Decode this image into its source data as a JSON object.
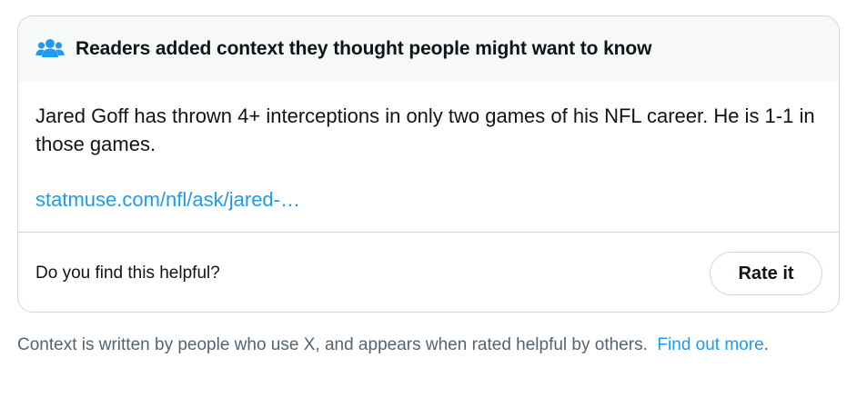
{
  "note": {
    "header_title": "Readers added context they thought people might want to know",
    "header_icon": "people-icon",
    "body_text": "Jared Goff has thrown 4+ interceptions in only two games of his NFL career. He is 1-1 in those games.",
    "link_text": "statmuse.com/nfl/ask/jared-…",
    "helpful_question": "Do you find this helpful?",
    "rate_button_label": "Rate it"
  },
  "footer": {
    "text": "Context is written by people who use X, and appears when rated helpful by others.",
    "link_text": "Find out more",
    "trailing": "."
  },
  "colors": {
    "accent": "#1d9bf0",
    "header_bg": "#f7f9f9",
    "border": "#cfd9de",
    "secondary_text": "#536471",
    "primary_text": "#0f1419"
  }
}
